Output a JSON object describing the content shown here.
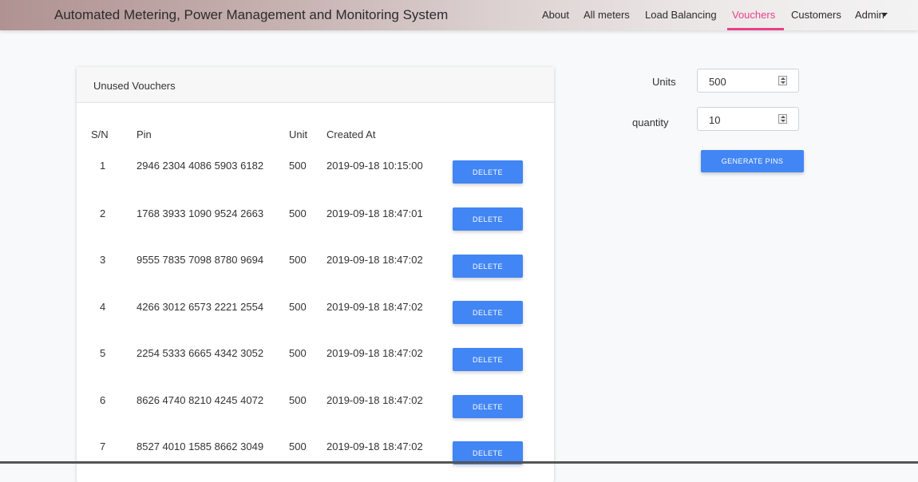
{
  "nav": {
    "brand": "Automated Metering, Power Management and Monitoring System",
    "links": [
      "About",
      "All meters",
      "Load Balancing",
      "Vouchers",
      "Customers",
      "Admin"
    ],
    "active": "Vouchers",
    "active_color": "#e5408a"
  },
  "card": {
    "title": "Unused Vouchers",
    "columns": {
      "sn": "S/N",
      "pin": "Pin",
      "unit": "Unit",
      "created": "Created At"
    },
    "rows": [
      {
        "sn": "1",
        "pin": "2946 2304 4086 5903 6182",
        "unit": "500",
        "created": "2019-09-18 10:15:00",
        "action": "DELETE"
      },
      {
        "sn": "2",
        "pin": "1768 3933 1090 9524 2663",
        "unit": "500",
        "created": "2019-09-18 18:47:01",
        "action": "DELETE"
      },
      {
        "sn": "3",
        "pin": "9555 7835 7098 8780 9694",
        "unit": "500",
        "created": "2019-09-18 18:47:02",
        "action": "DELETE"
      },
      {
        "sn": "4",
        "pin": "4266 3012 6573 2221 2554",
        "unit": "500",
        "created": "2019-09-18 18:47:02",
        "action": "DELETE"
      },
      {
        "sn": "5",
        "pin": "2254 5333 6665 4342 3052",
        "unit": "500",
        "created": "2019-09-18 18:47:02",
        "action": "DELETE"
      },
      {
        "sn": "6",
        "pin": "8626 4740 8210 4245 4072",
        "unit": "500",
        "created": "2019-09-18 18:47:02",
        "action": "DELETE"
      },
      {
        "sn": "7",
        "pin": "8527 4010 1585 8662 3049",
        "unit": "500",
        "created": "2019-09-18 18:47:02",
        "action": "DELETE"
      }
    ]
  },
  "form": {
    "units_label": "Units",
    "units_value": "500",
    "quantity_label": "quantity",
    "quantity_value": "10",
    "generate_label": "GENERATE PINS"
  },
  "colors": {
    "button": "#4285f4",
    "accent": "#e5408a"
  }
}
